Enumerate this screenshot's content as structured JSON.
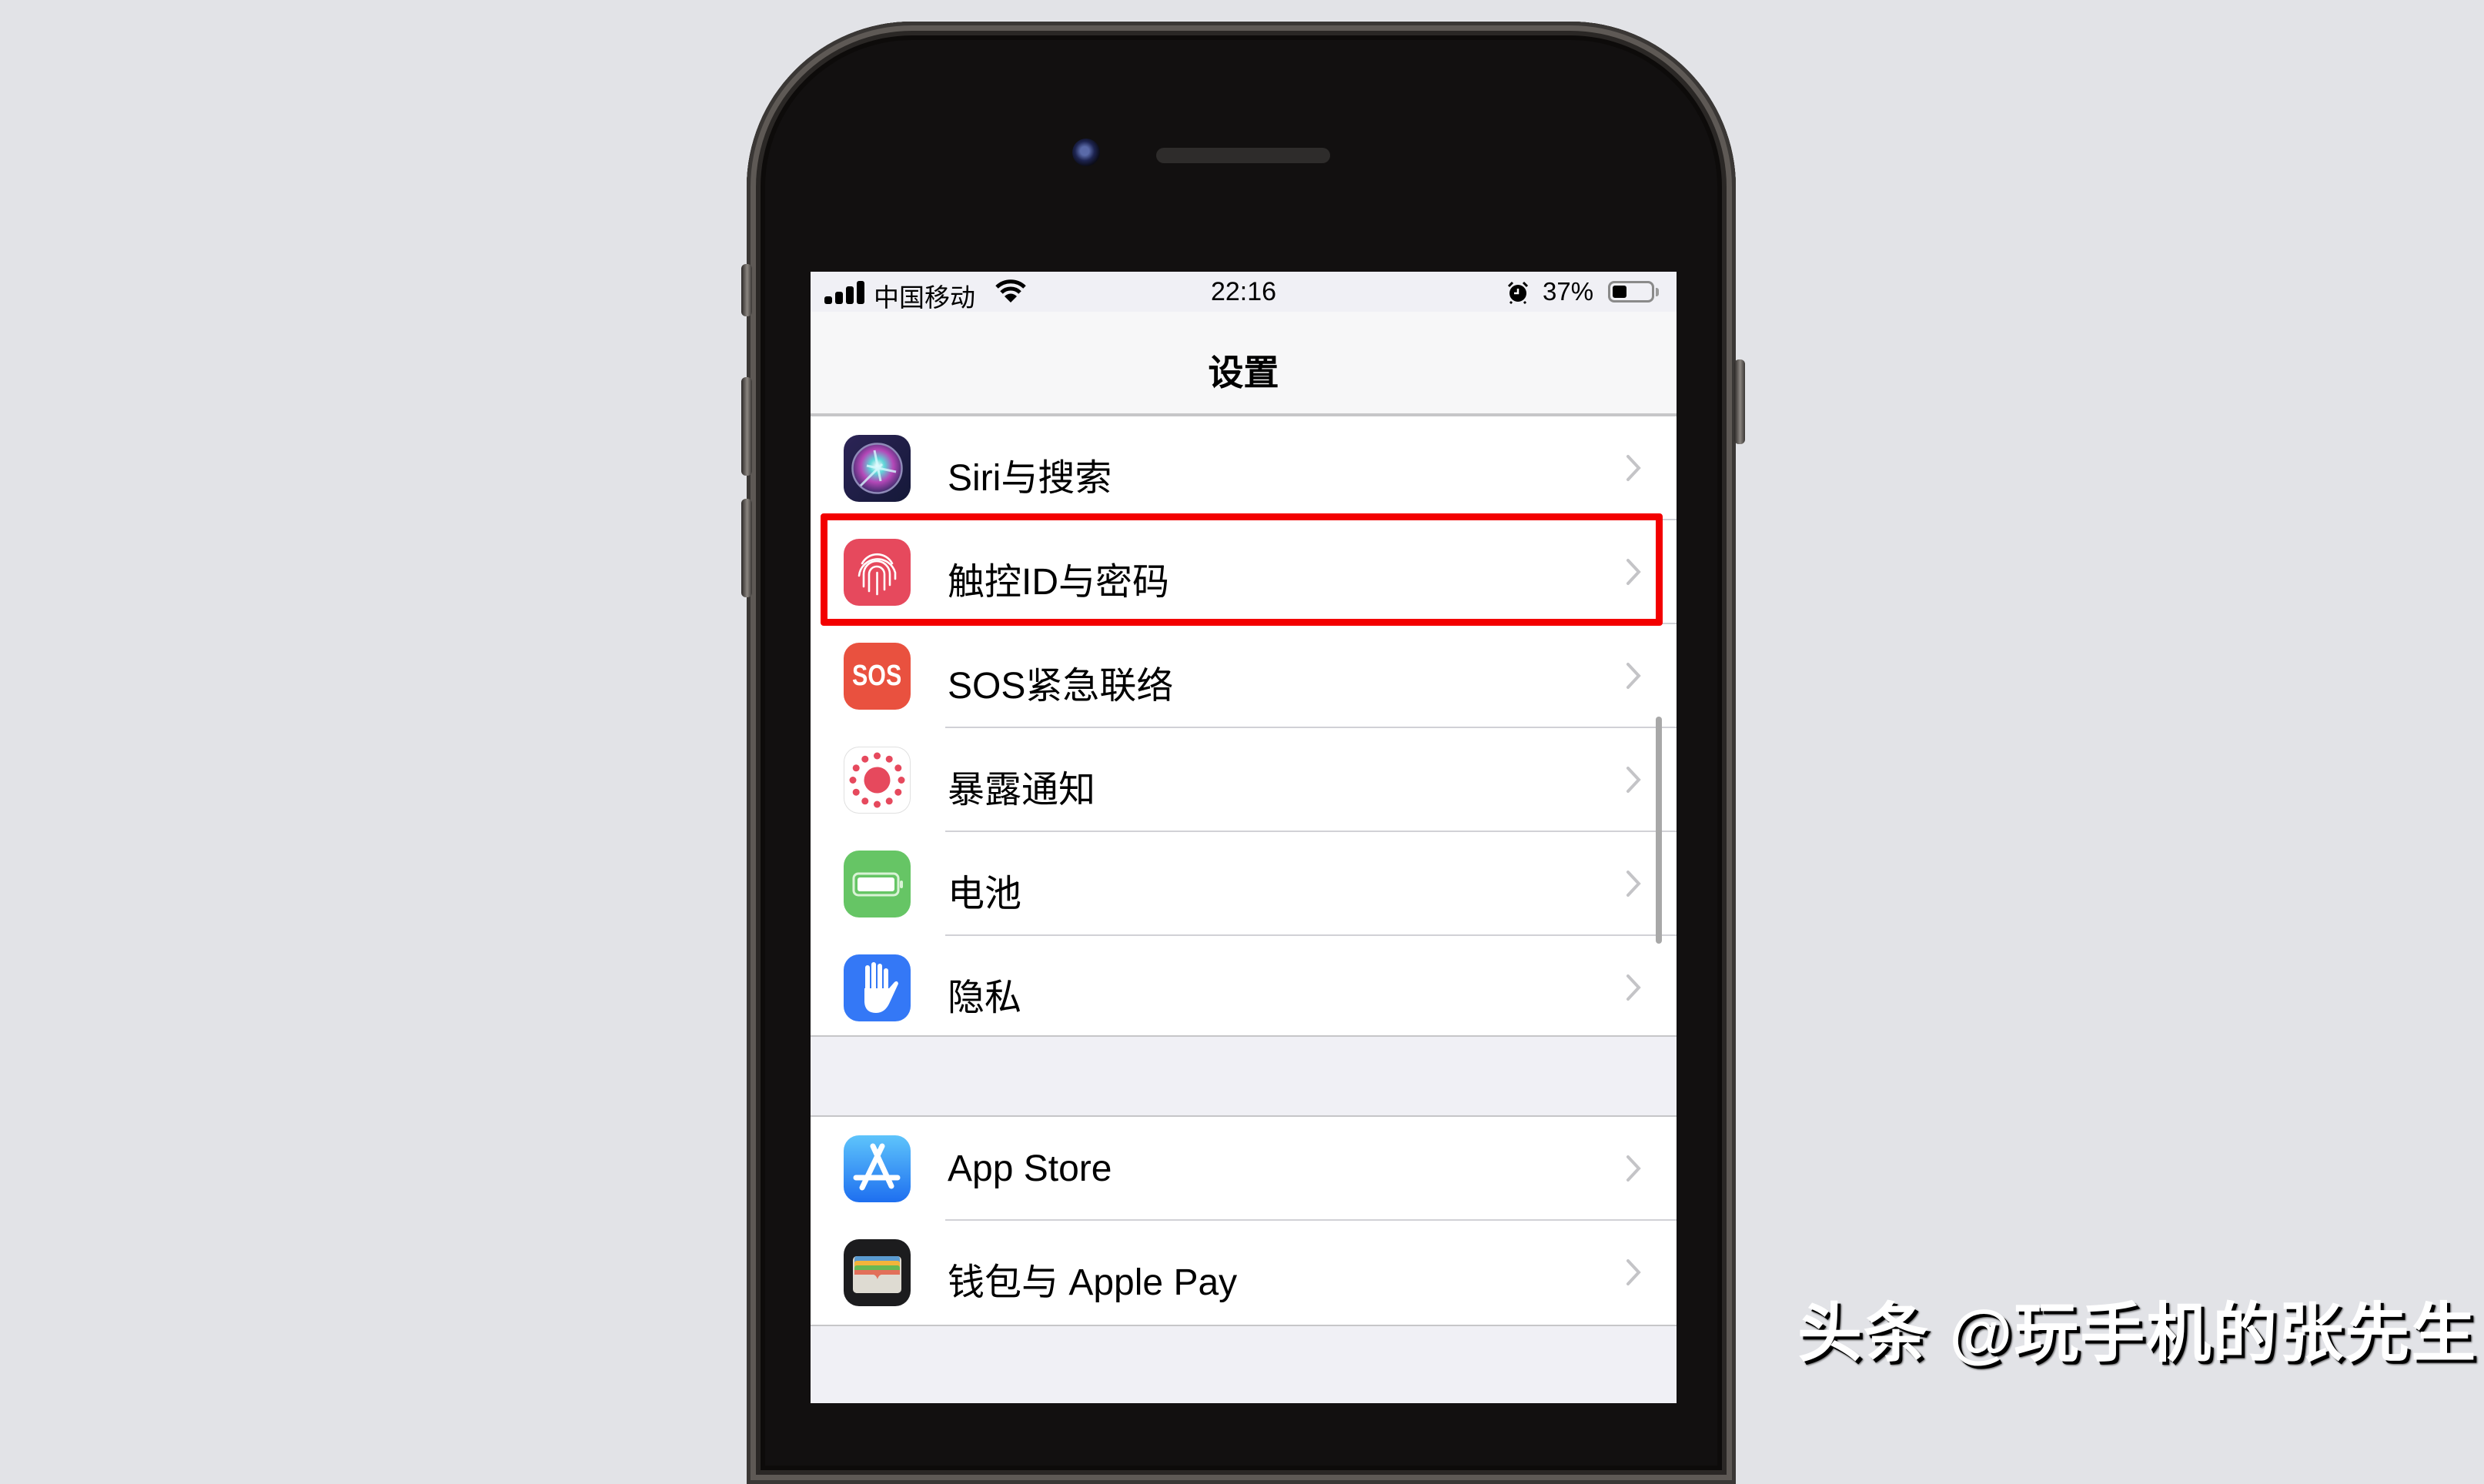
{
  "status_bar": {
    "carrier": "中国移动",
    "time": "22:16",
    "battery_percent_text": "37%",
    "battery_level": 0.37,
    "signal_bars": 4,
    "icons": [
      "signal-icon",
      "wifi-icon",
      "alarm-icon",
      "battery-icon"
    ]
  },
  "nav": {
    "title": "设置"
  },
  "groups": [
    {
      "items": [
        {
          "label": "Siri与搜索",
          "icon": "siri-icon"
        },
        {
          "label": "触控ID与密码",
          "icon": "fingerprint-icon",
          "highlighted": true
        },
        {
          "label": "SOS紧急联络",
          "icon": "sos-icon",
          "icon_text": "SOS"
        },
        {
          "label": "暴露通知",
          "icon": "exposure-notification-icon"
        },
        {
          "label": "电池",
          "icon": "battery-settings-icon"
        },
        {
          "label": "隐私",
          "icon": "privacy-hand-icon"
        }
      ]
    },
    {
      "items": [
        {
          "label": "App Store",
          "icon": "app-store-icon"
        },
        {
          "label": "钱包与 Apple Pay",
          "icon": "wallet-icon"
        }
      ]
    }
  ],
  "colors": {
    "highlight_box": "#f30000",
    "sos": "#e9513f",
    "touch_id": "#e6495d",
    "battery": "#66c565",
    "privacy": "#3478f6",
    "app_store": "#1a8cf5"
  },
  "watermark": "头条 @玩手机的张先生"
}
